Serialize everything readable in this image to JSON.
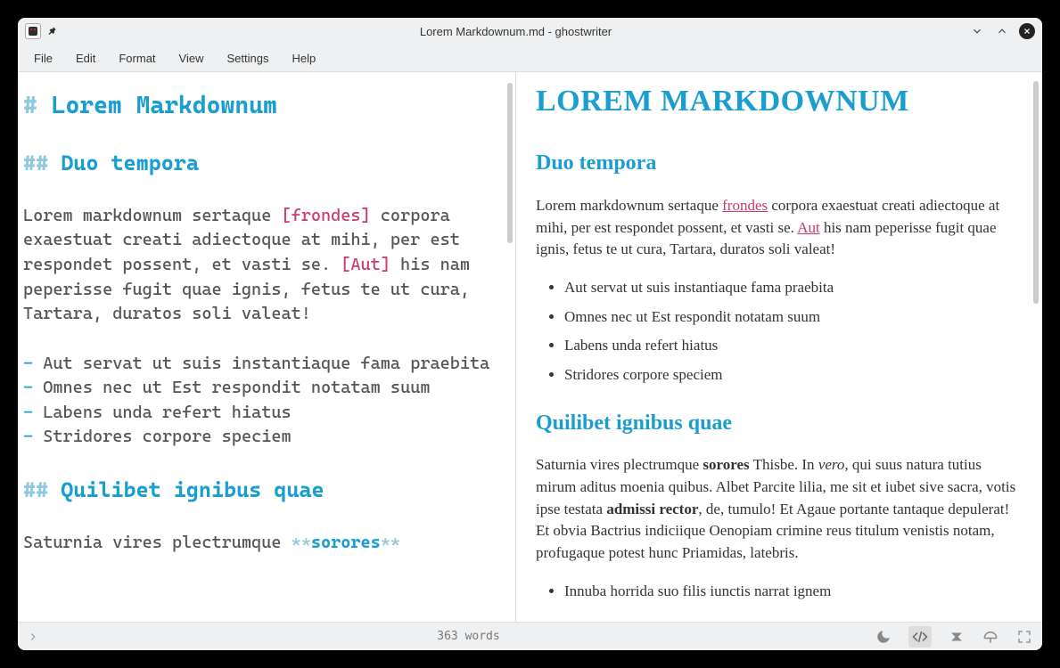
{
  "titlebar": {
    "title": "Lorem Markdownum.md - ghostwriter"
  },
  "menubar": {
    "items": [
      "File",
      "Edit",
      "Format",
      "View",
      "Settings",
      "Help"
    ]
  },
  "editor": {
    "h1_hash": "#",
    "h1_text": " Lorem Markdownum",
    "h2a_hash": "##",
    "h2a_text": " Duo tempora",
    "p1_a": "Lorem markdownum sertaque ",
    "p1_link1": "[frondes]",
    "p1_b": " corpora exaestuat creati adiectoque at mihi, per est respondet possent, et vasti se. ",
    "p1_link2": "[Aut]",
    "p1_c": " his nam peperisse fugit quae ignis, fetus te ut cura, Tartara, duratos soli valeat!",
    "list": [
      "Aut servat ut suis instantiaque fama praebita",
      "Omnes nec ut Est respondit notatam suum",
      "Labens unda refert hiatus",
      "Stridores corpore speciem"
    ],
    "dash": "-",
    "h2b_hash": "##",
    "h2b_text": " Quilibet ignibus quae",
    "p2_a": "Saturnia vires plectrumque ",
    "p2_boldmark": "**",
    "p2_bold": "sorores"
  },
  "preview": {
    "h1": "LOREM MARKDOWNUM",
    "h2a": "Duo tempora",
    "p1_a": "Lorem markdownum sertaque ",
    "p1_link1": "frondes",
    "p1_b": " corpora exaestuat creati adiectoque at mihi, per est respondet possent, et vasti se. ",
    "p1_link2": "Aut",
    "p1_c": " his nam peperisse fugit quae ignis, fetus te ut cura, Tartara, duratos soli valeat!",
    "list": [
      "Aut servat ut suis instantiaque fama praebita",
      "Omnes nec ut Est respondit notatam suum",
      "Labens unda refert hiatus",
      "Stridores corpore speciem"
    ],
    "h2b": "Quilibet ignibus quae",
    "p2_a": "Saturnia vires plectrumque ",
    "p2_b1": "sorores",
    "p2_c": " Thisbe. In ",
    "p2_em": "vero",
    "p2_d": ", qui suus natura tutius mirum aditus moenia quibus. Albet Parcite lilia, me sit et iubet sive sacra, votis ipse testata ",
    "p2_b2": "admissi rector",
    "p2_e": ", de, tumulo! Et Agaue portante tantaque depulerat! Et obvia Bactrius indiciique Oenopiam crimine reus titulum venistis notam, profugaque potest hunc Priamidas, latebris.",
    "list2_0": "Innuba horrida suo filis iunctis narrat ignem"
  },
  "statusbar": {
    "words": "363 words"
  }
}
